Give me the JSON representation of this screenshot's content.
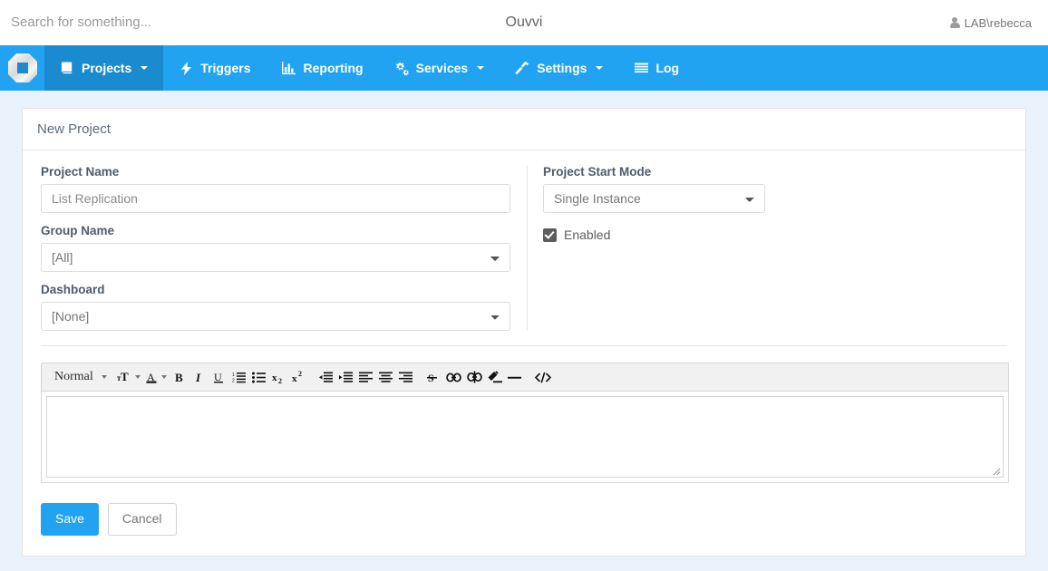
{
  "topbar": {
    "search_placeholder": "Search for something...",
    "search_value": "",
    "app_title": "Ouvvi",
    "user_name": "LAB\\rebecca",
    "user_icon": "user-icon"
  },
  "navbar": {
    "logo_icon": "ouvvi-logo-icon",
    "active_color": "#1b8bd0",
    "background_color": "#22a3f1",
    "items": [
      {
        "label": "Projects",
        "icon": "book-icon",
        "has_caret": true,
        "active": true
      },
      {
        "label": "Triggers",
        "icon": "bolt-icon",
        "has_caret": false,
        "active": false
      },
      {
        "label": "Reporting",
        "icon": "bar-chart-icon",
        "has_caret": false,
        "active": false
      },
      {
        "label": "Services",
        "icon": "cogs-icon",
        "has_caret": true,
        "active": false
      },
      {
        "label": "Settings",
        "icon": "magic-wand-icon",
        "has_caret": true,
        "active": false
      },
      {
        "label": "Log",
        "icon": "list-lines-icon",
        "has_caret": false,
        "active": false
      }
    ]
  },
  "card": {
    "header_title": "New Project"
  },
  "form": {
    "project_name": {
      "label": "Project Name",
      "placeholder": "List Replication",
      "value": ""
    },
    "group_name": {
      "label": "Group Name",
      "selected": "[All]",
      "options": [
        "[All]"
      ]
    },
    "dashboard": {
      "label": "Dashboard",
      "selected": "[None]",
      "options": [
        "[None]"
      ]
    },
    "project_start_mode": {
      "label": "Project Start Mode",
      "selected": "Single Instance",
      "options": [
        "Single Instance"
      ]
    },
    "enabled": {
      "label": "Enabled",
      "checked": true
    }
  },
  "editor": {
    "format_selector": "Normal",
    "content": "",
    "toolbar": [
      {
        "name": "font-size-icon",
        "glyph": "тT",
        "caret": true
      },
      {
        "name": "font-color-icon",
        "glyph": "A",
        "caret": true
      },
      {
        "name": "bold-icon",
        "glyph": "B",
        "caret": false
      },
      {
        "name": "italic-icon",
        "glyph": "I",
        "caret": false
      },
      {
        "name": "underline-icon",
        "glyph": "U",
        "caret": false
      },
      {
        "name": "ordered-list-icon",
        "glyph": "",
        "caret": false
      },
      {
        "name": "unordered-list-icon",
        "glyph": "",
        "caret": false
      },
      {
        "name": "subscript-icon",
        "glyph": "x",
        "caret": false
      },
      {
        "name": "superscript-icon",
        "glyph": "x",
        "caret": false
      },
      {
        "name": "outdent-icon",
        "glyph": "",
        "caret": false
      },
      {
        "name": "indent-icon",
        "glyph": "",
        "caret": false
      },
      {
        "name": "align-left-icon",
        "glyph": "",
        "caret": false
      },
      {
        "name": "align-center-icon",
        "glyph": "",
        "caret": false
      },
      {
        "name": "align-right-icon",
        "glyph": "",
        "caret": false
      },
      {
        "name": "strikethrough-icon",
        "glyph": "S",
        "caret": false
      },
      {
        "name": "link-icon",
        "glyph": "",
        "caret": false
      },
      {
        "name": "unlink-icon",
        "glyph": "",
        "caret": false
      },
      {
        "name": "clear-format-icon",
        "glyph": "",
        "caret": false
      },
      {
        "name": "horizontal-rule-icon",
        "glyph": "",
        "caret": false
      },
      {
        "name": "code-view-icon",
        "glyph": "</>",
        "caret": false
      }
    ]
  },
  "actions": {
    "save_label": "Save",
    "cancel_label": "Cancel",
    "primary_color": "#22a3f1"
  }
}
